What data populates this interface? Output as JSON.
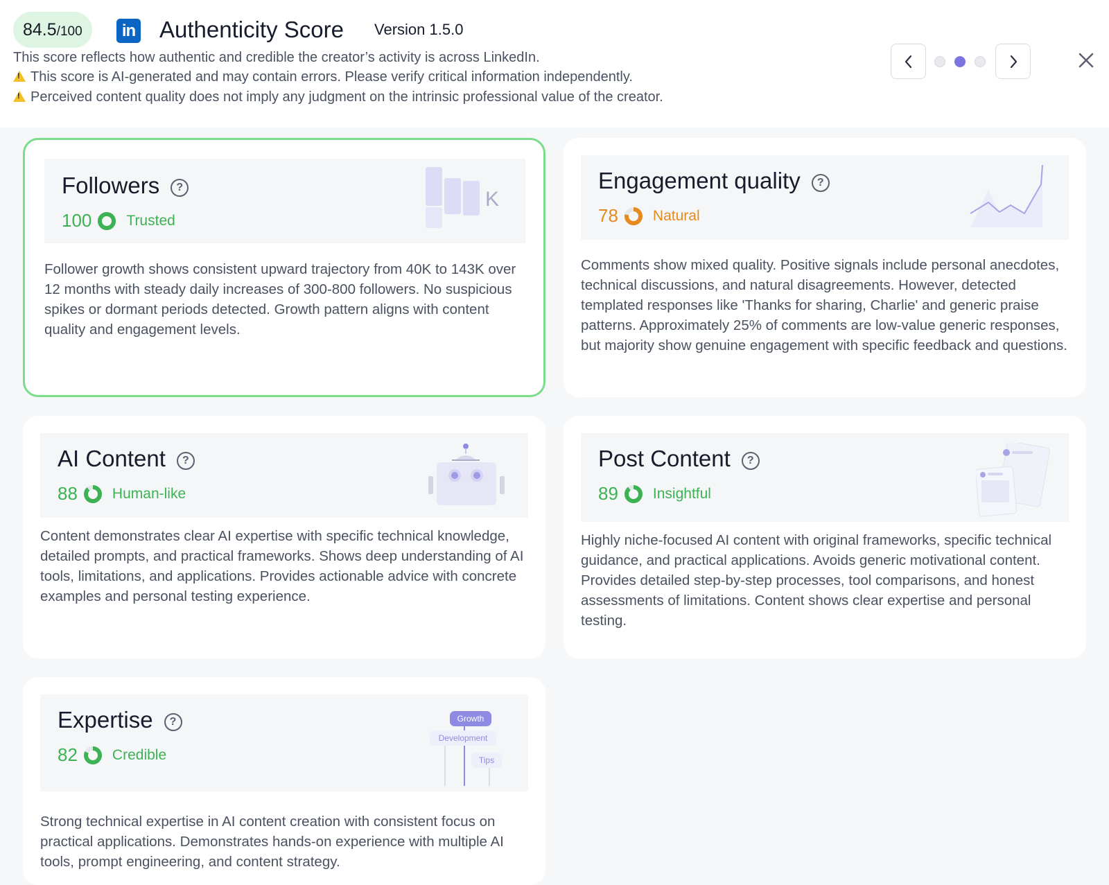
{
  "header": {
    "score_value": "84.5",
    "score_max": "/100",
    "logo_text": "in",
    "title": "Authenticity Score",
    "version": "Version 1.5.0",
    "line1": "This score reflects how authentic and credible the creator’s activity is across LinkedIn.",
    "line2": "This score is AI-generated and may contain errors. Please verify critical information independently.",
    "line3": "Perceived content quality does not imply any judgment on the intrinsic professional value of the creator."
  },
  "pager": {
    "count": 3,
    "active_index": 1
  },
  "help_glyph": "?",
  "cards": {
    "followers": {
      "title": "Followers",
      "score": "100",
      "label": "Trusted",
      "fill": 1.0,
      "deco_letter": "K",
      "description": "Follower growth shows consistent upward trajectory from 40K to 143K over 12 months with steady daily increases of 300-800 followers. No suspicious spikes or dormant periods detected. Growth pattern aligns with content quality and engagement levels."
    },
    "engagement": {
      "title": "Engagement quality",
      "score": "78",
      "label": "Natural",
      "fill": 0.78,
      "description": "Comments show mixed quality. Positive signals include personal anecdotes, technical discussions, and natural disagreements. However, detected templated responses like 'Thanks for sharing, Charlie' and generic praise patterns. Approximately 25% of comments are low-value generic responses, but majority show genuine engagement with specific feedback and questions."
    },
    "ai_content": {
      "title": "AI Content",
      "score": "88",
      "label": "Human-like",
      "fill": 0.88,
      "description": "Content demonstrates clear AI expertise with specific technical knowledge, detailed prompts, and practical frameworks. Shows deep understanding of AI tools, limitations, and applications. Provides actionable advice with concrete examples and personal testing experience."
    },
    "post_content": {
      "title": "Post Content",
      "score": "89",
      "label": "Insightful",
      "fill": 0.89,
      "description": "Highly niche-focused AI content with original frameworks, specific technical guidance, and practical applications. Avoids generic motivational content. Provides detailed step-by-step processes, tool comparisons, and honest assessments of limitations. Content shows clear expertise and personal testing."
    },
    "expertise": {
      "title": "Expertise",
      "score": "82",
      "label": "Credible",
      "fill": 0.82,
      "tags": [
        "Growth",
        "Development",
        "Tips"
      ],
      "description": "Strong technical expertise in AI content creation with consistent focus on practical applications. Demonstrates hands-on experience with multiple AI tools, prompt engineering, and content strategy."
    }
  },
  "colors": {
    "green": "#3db254",
    "orange": "#e58a1f",
    "accent": "#7c74e0",
    "highlight_border": "#7bdc8c"
  }
}
